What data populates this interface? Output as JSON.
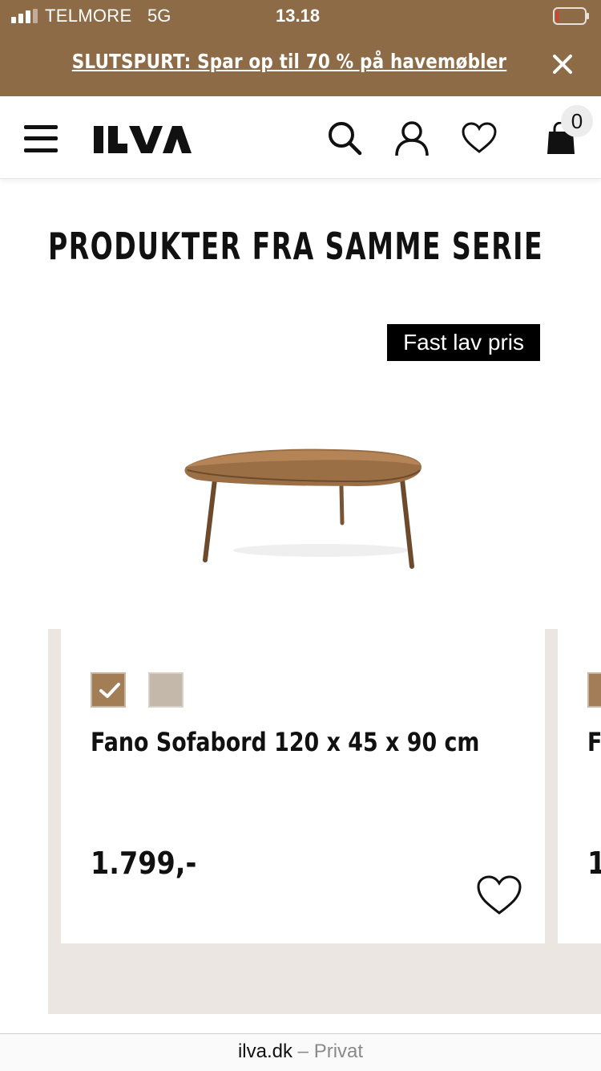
{
  "status_bar": {
    "carrier": "TELMORE",
    "network": "5G",
    "time": "13.18"
  },
  "promo": {
    "text": "SLUTSPURT: Spar op til 70 % på havemøbler",
    "background": "#8e6b47"
  },
  "header": {
    "brand": "ILVA",
    "icons": [
      "menu-icon",
      "search-icon",
      "account-icon",
      "heart-icon",
      "shopping-bag-icon"
    ],
    "cart_count": "0"
  },
  "section": {
    "title": "PRODUKTER FRA SAMME SERIE"
  },
  "products": [
    {
      "badge": "Fast lav pris",
      "name": "Fano Sofabord 120 x 45 x 90 cm",
      "price": "1.799,-",
      "swatches": [
        {
          "color": "#a27d55",
          "selected": true
        },
        {
          "color": "#c4b8aa",
          "selected": false
        }
      ]
    },
    {
      "name_visible": "F",
      "price_visible": "1",
      "swatch_color": "#a27d55"
    }
  ],
  "url_bar": {
    "domain": "ilva.dk",
    "separator": "–",
    "mode": "Privat"
  }
}
